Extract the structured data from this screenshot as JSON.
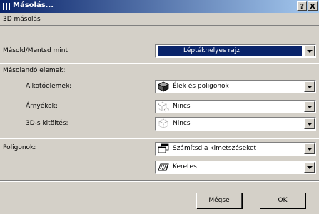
{
  "window": {
    "title": "Másolás...",
    "help_label": "?",
    "close_label": "X"
  },
  "header": {
    "section_title": "3D másolás"
  },
  "copy_as": {
    "label": "Másold/Mentsd mint:",
    "value": "Léptékhelyes rajz"
  },
  "elements_section": {
    "title": "Másolandó elemek:",
    "rows": [
      {
        "label": "Alkotóelemek:",
        "value": "Élek és poligonok",
        "icon": "cube-shaded-icon"
      },
      {
        "label": "Árnyékok:",
        "value": "Nincs",
        "icon": "shadow-none-icon"
      },
      {
        "label": "3D-s kitöltés:",
        "value": "Nincs",
        "icon": "fill-none-icon"
      }
    ]
  },
  "polygons": {
    "label": "Poligonok:",
    "calc_value": "Számítsd a kimetszéseket",
    "calc_icon": "overlapping-windows-icon",
    "frame_value": "Keretes",
    "frame_icon": "hatch-frame-icon"
  },
  "buttons": {
    "cancel": "Mégse",
    "ok": "OK"
  },
  "colors": {
    "titlebar_start": "#0a246a",
    "titlebar_end": "#a6caf0",
    "face": "#d4d0c8",
    "selection": "#0a246a"
  }
}
